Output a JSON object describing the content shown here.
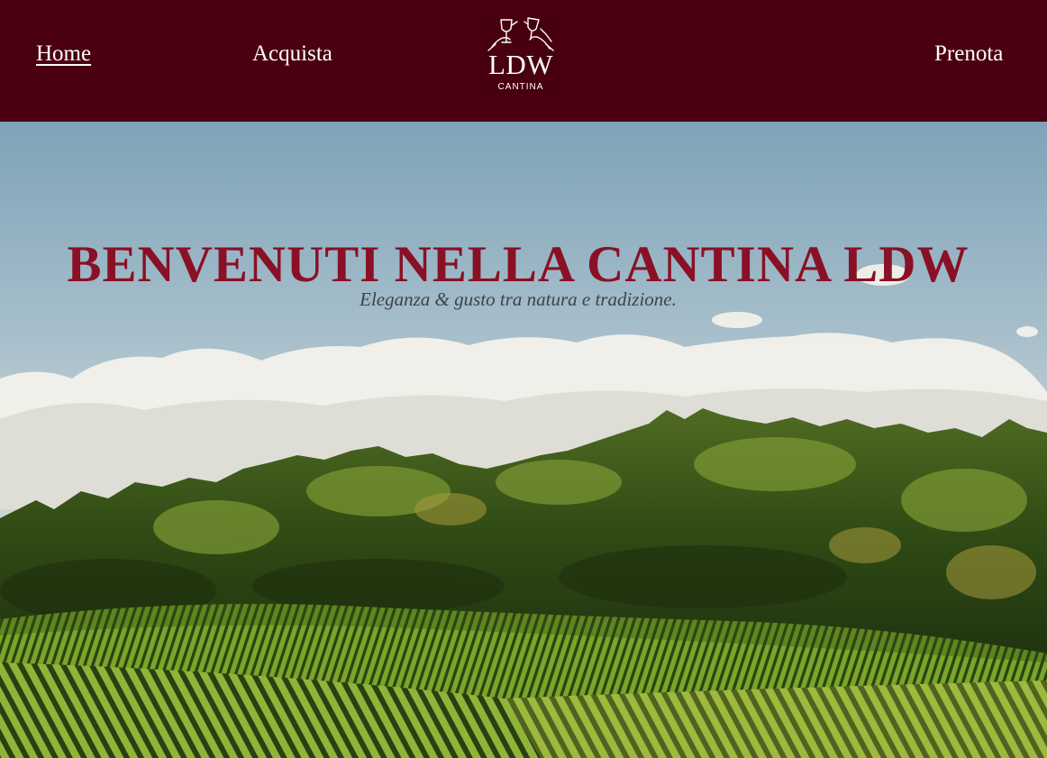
{
  "nav": {
    "home_label": "Home",
    "shop_label": "Acquista",
    "book_label": "Prenota"
  },
  "logo": {
    "name": "LDW",
    "subtitle": "CANTINA",
    "icon": "wine-glasses-icon"
  },
  "hero": {
    "title": "BENVENUTI NELLA CANTINA LDW",
    "subtitle": "Eleganza & gusto tra natura e tradizione.",
    "image": "vineyard-landscape"
  },
  "colors": {
    "header_bg": "#4b0012",
    "title_accent": "#8a1026",
    "nav_text": "#ffffff"
  }
}
